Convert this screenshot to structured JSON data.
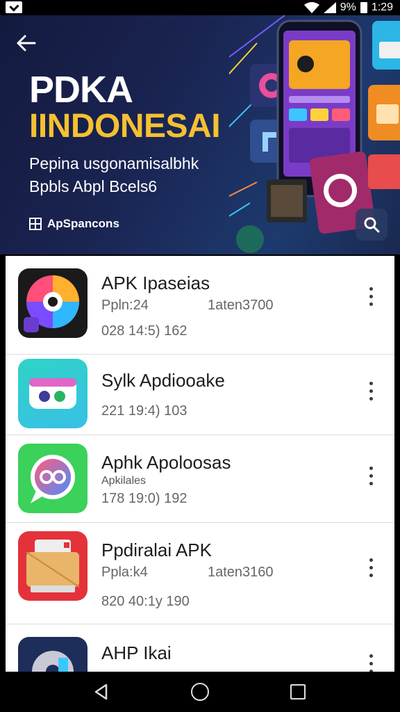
{
  "status_bar": {
    "percent": "9%",
    "time": "1:29"
  },
  "hero": {
    "title_line1": "PDKA",
    "title_line2": "IINDONESAI",
    "subtitle_line1": "Pepina usgonamisalbhk",
    "subtitle_line2": "Bpbls Abpl Bcels6",
    "brand_label": "ApSpancons"
  },
  "apps": [
    {
      "name": "APK Ipaseias",
      "meta1": "Ppln:24",
      "meta1_right": "1aten3700",
      "meta2": "028 14:5) 162",
      "icon": "color-wheel-icon",
      "icon_color": "#1a1a1a"
    },
    {
      "name": "Sylk Apdiooake",
      "meta2": "221 19:4) 103",
      "icon": "toggle-dots-icon",
      "icon_color": "#2fd3c6"
    },
    {
      "name": "Aphk Apoloosas",
      "meta1_small": "Apkilales",
      "meta2": "178 19:0) 192",
      "icon": "chat-bubble-icon",
      "icon_color": "#3bd15a"
    },
    {
      "name": "Ppdiralai APK",
      "meta1": "Ppla:k4",
      "meta1_right": "1aten3160",
      "meta2": "820 40:1y 190",
      "icon": "printer-box-icon",
      "icon_color": "#e4323a"
    },
    {
      "name": "AHP Ikai",
      "icon": "disc-icon",
      "icon_color": "#1e2e5a"
    }
  ],
  "colors": {
    "accent_yellow": "#f5c132",
    "hero_bg": "#1a2452"
  }
}
